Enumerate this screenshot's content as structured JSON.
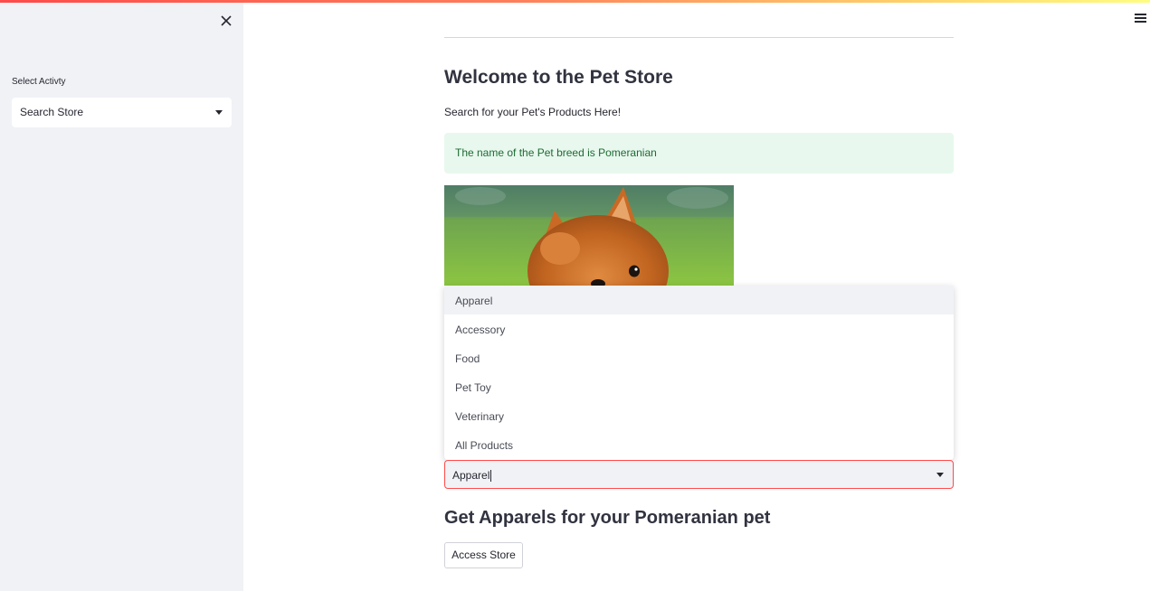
{
  "sidebar": {
    "label": "Select Activty",
    "select_value": "Search Store"
  },
  "main": {
    "title": "Welcome to the Pet Store",
    "subtitle": "Search for your Pet's Products Here!",
    "alert_text": "The name of the Pet breed is Pomeranian",
    "dropdown_options": [
      "Apparel",
      "Accessory",
      "Food",
      "Pet Toy",
      "Veterinary",
      "All Products"
    ],
    "select_value": "Apparel",
    "heading2": "Get Apparels for your Pomeranian pet",
    "button_label": "Access Store"
  },
  "icons": {
    "close": "close-icon",
    "menu": "hamburger-menu-icon",
    "caret": "chevron-down-icon"
  },
  "colors": {
    "accent": "#ff4b4b",
    "sidebar_bg": "#f0f2f6",
    "alert_bg": "#e8f8ee",
    "alert_text": "#1e6b33"
  }
}
